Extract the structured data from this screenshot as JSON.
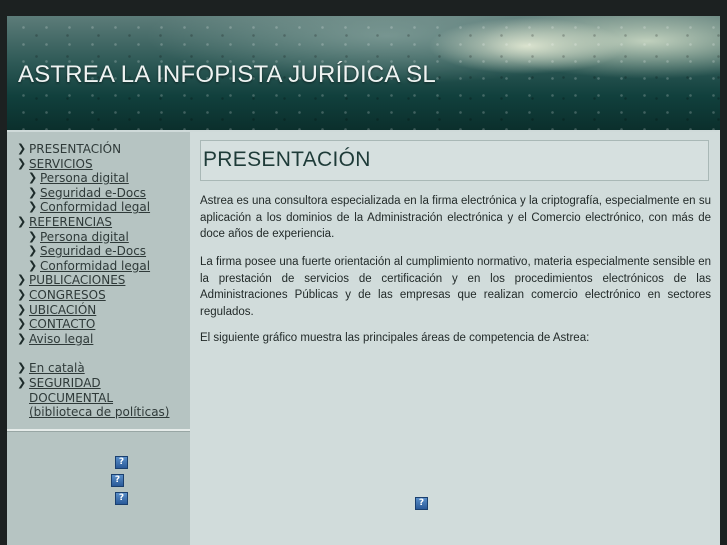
{
  "header": {
    "title": "ASTREA LA INFOPISTA JURÍDICA SL"
  },
  "sidebar": {
    "items": [
      {
        "label": "PRESENTACIÓN",
        "level": "top",
        "current": true
      },
      {
        "label": "SERVICIOS",
        "level": "top"
      },
      {
        "label": "Persona digital",
        "level": "sub"
      },
      {
        "label": "Seguridad e-Docs",
        "level": "sub"
      },
      {
        "label": "Conformidad legal",
        "level": "sub"
      },
      {
        "label": "REFERENCIAS",
        "level": "top"
      },
      {
        "label": "Persona digital",
        "level": "sub"
      },
      {
        "label": "Seguridad e-Docs",
        "level": "sub"
      },
      {
        "label": "Conformidad legal",
        "level": "sub"
      },
      {
        "label": "PUBLICACIONES",
        "level": "top"
      },
      {
        "label": "CONGRESOS",
        "level": "top"
      },
      {
        "label": "UBICACIÓN",
        "level": "top"
      },
      {
        "label": "CONTACTO",
        "level": "top"
      },
      {
        "label": "Aviso legal",
        "level": "top"
      }
    ],
    "extra_items": [
      {
        "label": "En català"
      },
      {
        "label": "SEGURIDAD DOCUMENTAL (biblioteca de políticas)"
      }
    ],
    "icons": [
      "question-icon",
      "question-icon",
      "question-icon"
    ]
  },
  "main": {
    "heading": "PRESENTACIÓN",
    "paragraphs": [
      "Astrea es una consultora especializada en la firma electrónica y la criptografía, especialmente en su aplicación a los dominios de la Administración electrónica y el Comercio electrónico, con más de doce años de experiencia.",
      "La firma posee una fuerte orientación al cumplimiento normativo, materia especialmente sensible en la prestación de servicios de certificación y en los procedimientos electrónicos de las Administraciones Públicas y de las empresas que realizan comercio electrónico en sectores regulados.",
      "El siguiente gráfico muestra las principales áreas de competencia de Astrea:"
    ],
    "broken_image_icon": "question-icon",
    "icon_glyph": "?"
  },
  "colors": {
    "page_bg": "#1c2121",
    "sidebar_bg": "#b6c4c2",
    "content_bg": "#d1dcdb",
    "heading_color": "#1e3b38"
  }
}
